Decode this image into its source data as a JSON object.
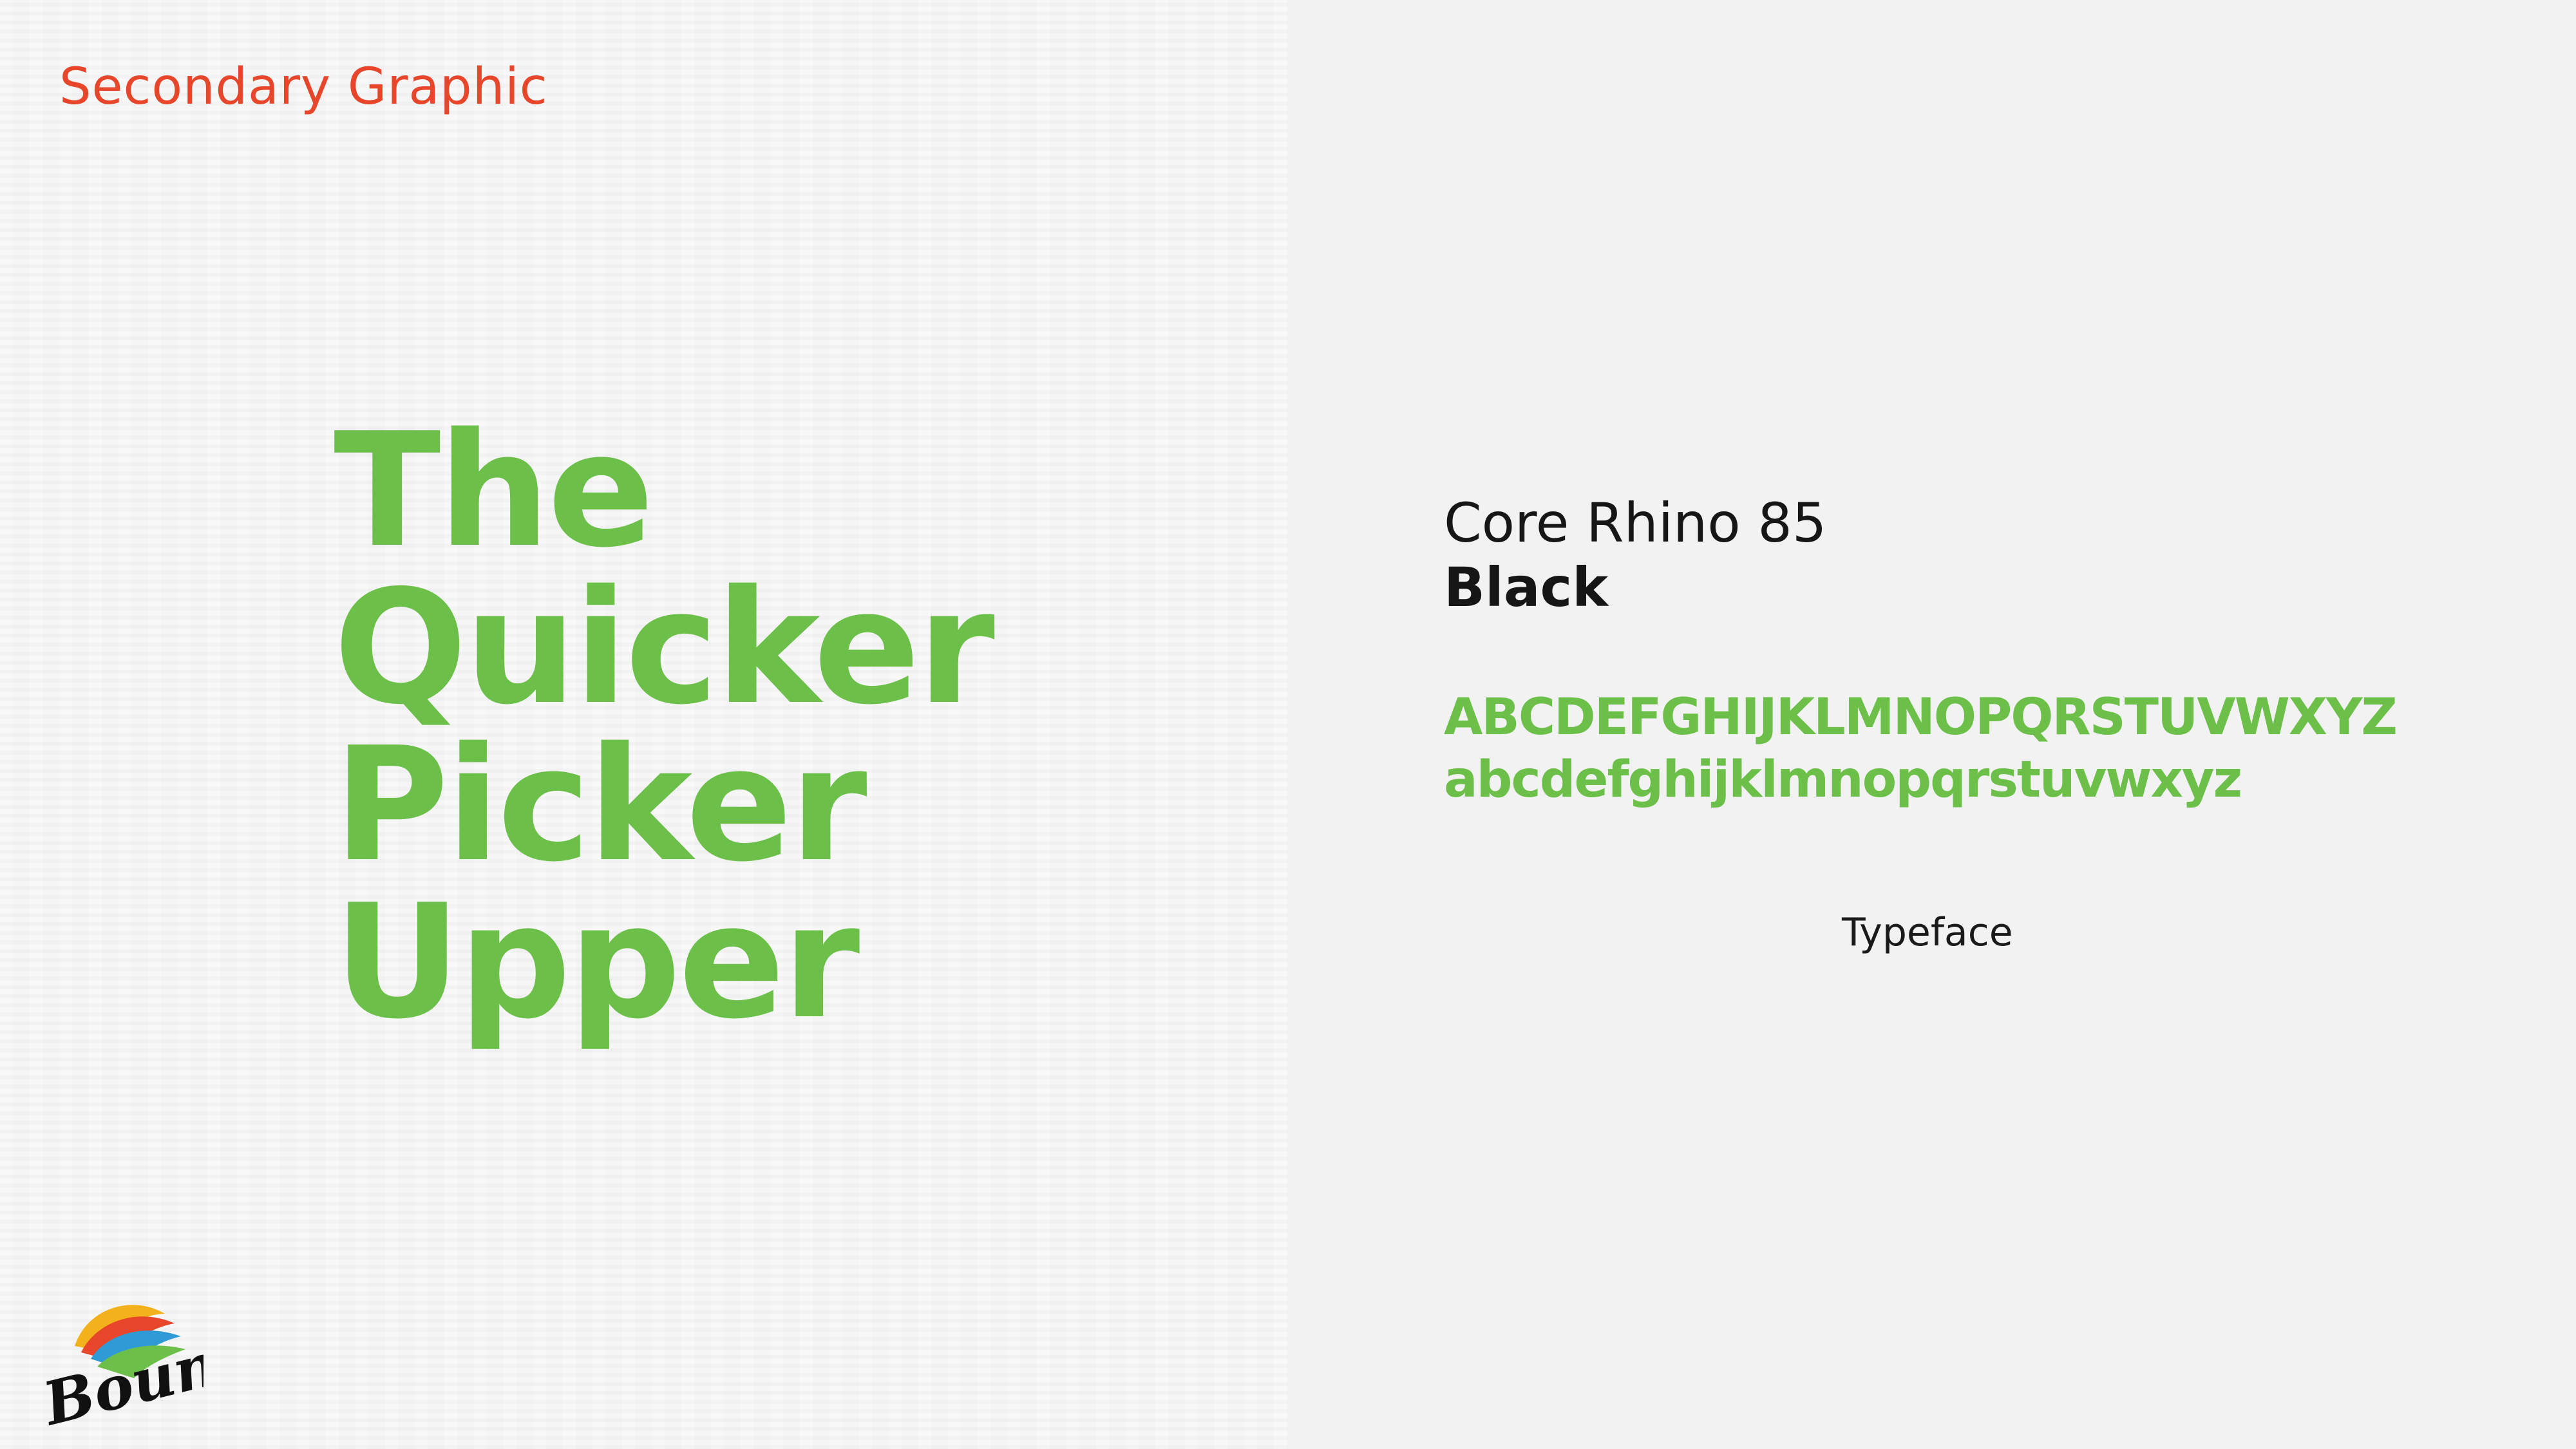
{
  "slide": {
    "section_label": "Secondary Graphic",
    "headline_lines": [
      "The",
      "Quicker",
      "Picker",
      "Upper"
    ],
    "font_name": "Core Rhino 85",
    "font_weight": "Black",
    "alphabet_upper": "ABCDEFGHIJKLMNOPQRSTUVWXYZ",
    "alphabet_lower": "abcdefghijklmnopqrstuvwxyz",
    "caption": "Typeface"
  },
  "logo": {
    "text": "Bounty",
    "icon": "bounty-logo-icon"
  },
  "colors": {
    "accent_orange": "#e8462a",
    "brand_green": "#6cc04a",
    "text_dark": "#161616",
    "background": "#f2f2f2"
  }
}
